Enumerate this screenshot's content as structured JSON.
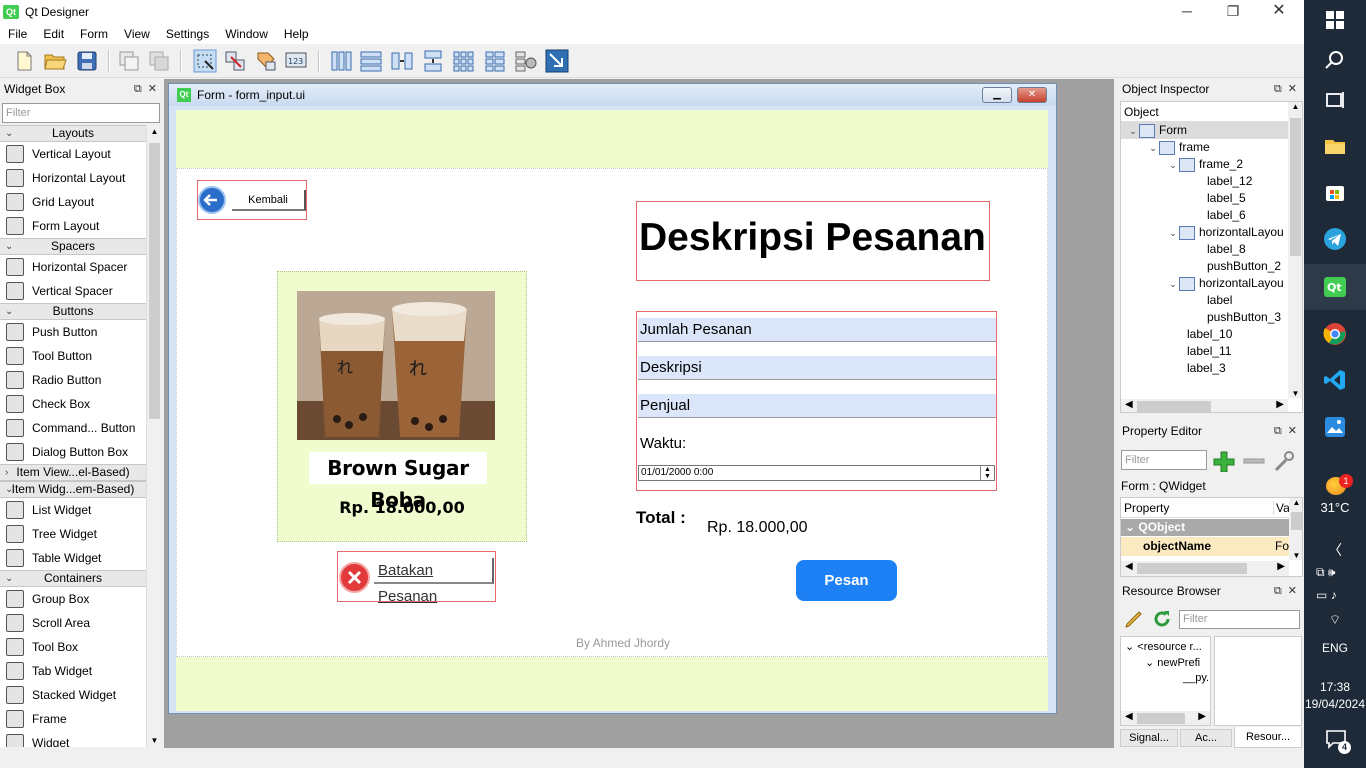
{
  "app": {
    "title": "Qt Designer"
  },
  "menu": [
    "File",
    "Edit",
    "Form",
    "View",
    "Settings",
    "Window",
    "Help"
  ],
  "widget_box": {
    "title": "Widget Box",
    "filter_placeholder": "Filter",
    "rows": [
      {
        "type": "cat",
        "label": "Layouts",
        "open": true
      },
      {
        "type": "item",
        "label": "Vertical Layout",
        "icon": "vertical-layout-icon"
      },
      {
        "type": "item",
        "label": "Horizontal Layout",
        "icon": "horizontal-layout-icon"
      },
      {
        "type": "item",
        "label": "Grid Layout",
        "icon": "grid-layout-icon"
      },
      {
        "type": "item",
        "label": "Form Layout",
        "icon": "form-layout-icon"
      },
      {
        "type": "cat",
        "label": "Spacers",
        "open": true
      },
      {
        "type": "item",
        "label": "Horizontal Spacer",
        "icon": "horizontal-spacer-icon"
      },
      {
        "type": "item",
        "label": "Vertical Spacer",
        "icon": "vertical-spacer-icon"
      },
      {
        "type": "cat",
        "label": "Buttons",
        "open": true
      },
      {
        "type": "item",
        "label": "Push Button",
        "icon": "push-button-icon"
      },
      {
        "type": "item",
        "label": "Tool Button",
        "icon": "tool-button-icon"
      },
      {
        "type": "item",
        "label": "Radio Button",
        "icon": "radio-button-icon"
      },
      {
        "type": "item",
        "label": "Check Box",
        "icon": "check-box-icon"
      },
      {
        "type": "item",
        "label": "Command... Button",
        "icon": "command-button-icon"
      },
      {
        "type": "item",
        "label": "Dialog Button Box",
        "icon": "dialog-button-box-icon"
      },
      {
        "type": "cat",
        "label": "Item View...el-Based)",
        "open": false
      },
      {
        "type": "cat",
        "label": "Item Widg...em-Based)",
        "open": true
      },
      {
        "type": "item",
        "label": "List Widget",
        "icon": "list-widget-icon"
      },
      {
        "type": "item",
        "label": "Tree Widget",
        "icon": "tree-widget-icon"
      },
      {
        "type": "item",
        "label": "Table Widget",
        "icon": "table-widget-icon"
      },
      {
        "type": "cat",
        "label": "Containers",
        "open": true
      },
      {
        "type": "item",
        "label": "Group Box",
        "icon": "group-box-icon"
      },
      {
        "type": "item",
        "label": "Scroll Area",
        "icon": "scroll-area-icon"
      },
      {
        "type": "item",
        "label": "Tool Box",
        "icon": "tool-box-icon"
      },
      {
        "type": "item",
        "label": "Tab Widget",
        "icon": "tab-widget-icon"
      },
      {
        "type": "item",
        "label": "Stacked Widget",
        "icon": "stacked-widget-icon"
      },
      {
        "type": "item",
        "label": "Frame",
        "icon": "frame-icon"
      },
      {
        "type": "item",
        "label": "Widget",
        "icon": "widget-icon"
      }
    ]
  },
  "form_window": {
    "title": "Form - form_input.ui",
    "back_button": "Kembali",
    "product_name": "Brown Sugar Boba",
    "product_price": "Rp. 18.000,00",
    "cancel_button": "Batakan Pesanan",
    "heading": "Deskripsi Pesanan",
    "fields": [
      "Jumlah Pesanan",
      "Deskripsi",
      "Penjual"
    ],
    "time_label": "Waktu:",
    "datetime_value": "01/01/2000 0:00",
    "total_label": "Total :",
    "total_value": "Rp. 18.000,00",
    "order_button": "Pesan",
    "credit": "By Ahmed Jhordy",
    "accent_color": "#1e80f5",
    "band_color": "#f0fbce"
  },
  "object_inspector": {
    "title": "Object Inspector",
    "header": "Object",
    "tree": [
      {
        "label": "Form",
        "depth": 0,
        "exp": "open",
        "icon": "form-icon",
        "sel": true
      },
      {
        "label": "frame",
        "depth": 1,
        "exp": "open",
        "icon": "frame-icon",
        "sel": false
      },
      {
        "label": "frame_2",
        "depth": 2,
        "exp": "open",
        "icon": "frame-icon",
        "sel": false
      },
      {
        "label": "label_12",
        "depth": 3,
        "exp": "",
        "icon": "",
        "sel": false
      },
      {
        "label": "label_5",
        "depth": 3,
        "exp": "",
        "icon": "",
        "sel": false
      },
      {
        "label": "label_6",
        "depth": 3,
        "exp": "",
        "icon": "",
        "sel": false
      },
      {
        "label": "horizontalLayou",
        "depth": 2,
        "exp": "open",
        "icon": "horizontal-layout-icon",
        "sel": false
      },
      {
        "label": "label_8",
        "depth": 3,
        "exp": "",
        "icon": "",
        "sel": false
      },
      {
        "label": "pushButton_2",
        "depth": 3,
        "exp": "",
        "icon": "",
        "sel": false
      },
      {
        "label": "horizontalLayou",
        "depth": 2,
        "exp": "open",
        "icon": "horizontal-layout-icon",
        "sel": false
      },
      {
        "label": "label",
        "depth": 3,
        "exp": "",
        "icon": "",
        "sel": false
      },
      {
        "label": "pushButton_3",
        "depth": 3,
        "exp": "",
        "icon": "",
        "sel": false
      },
      {
        "label": "label_10",
        "depth": 2,
        "exp": "",
        "icon": "",
        "sel": false
      },
      {
        "label": "label_11",
        "depth": 2,
        "exp": "",
        "icon": "",
        "sel": false
      },
      {
        "label": "label_3",
        "depth": 2,
        "exp": "",
        "icon": "",
        "sel": false
      }
    ]
  },
  "property_editor": {
    "title": "Property Editor",
    "filter_placeholder": "Filter",
    "context": "Form : QWidget",
    "col_property": "Property",
    "col_value": "Va",
    "group": "QObject",
    "row_name": "objectName",
    "row_value": "Fo"
  },
  "resource_browser": {
    "title": "Resource Browser",
    "filter_placeholder": "Filter",
    "tree": [
      "<resource r...",
      "newPrefi",
      "__py..."
    ],
    "tabs": [
      "Signal...",
      "Ac...",
      "Resour..."
    ]
  },
  "taskbar": {
    "temperature": "31°C",
    "language": "ENG",
    "time": "17:38",
    "date": "19/04/2024",
    "weather_badge": "1",
    "notification_count": "4"
  }
}
